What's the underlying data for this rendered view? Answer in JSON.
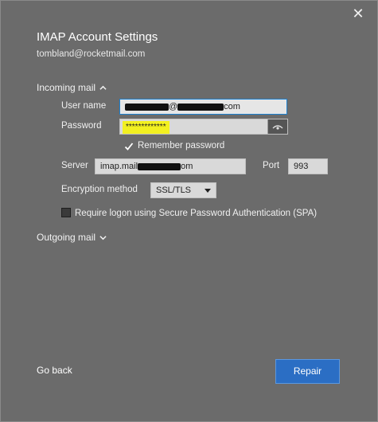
{
  "window": {
    "title": "IMAP Account Settings",
    "account_email": "tombland@rocketmail.com",
    "close_glyph": "✕"
  },
  "incoming": {
    "header": "Incoming mail",
    "username_label": "User name",
    "username_suffix": "com",
    "username_at": "@",
    "password_label": "Password",
    "password_mask": "*************",
    "remember_label": "Remember password",
    "remember_checked": true,
    "server_label": "Server",
    "server_prefix": "imap.mail",
    "server_suffix": "om",
    "port_label": "Port",
    "port_value": "993",
    "encryption_label": "Encryption method",
    "encryption_value": "SSL/TLS",
    "spa_label": "Require logon using Secure Password Authentication (SPA)",
    "spa_checked": false
  },
  "outgoing": {
    "header": "Outgoing mail"
  },
  "footer": {
    "back_label": "Go back",
    "repair_label": "Repair"
  },
  "colors": {
    "background": "#6b6b6b",
    "accent": "#2b6ec4",
    "highlight": "#f2f020"
  }
}
